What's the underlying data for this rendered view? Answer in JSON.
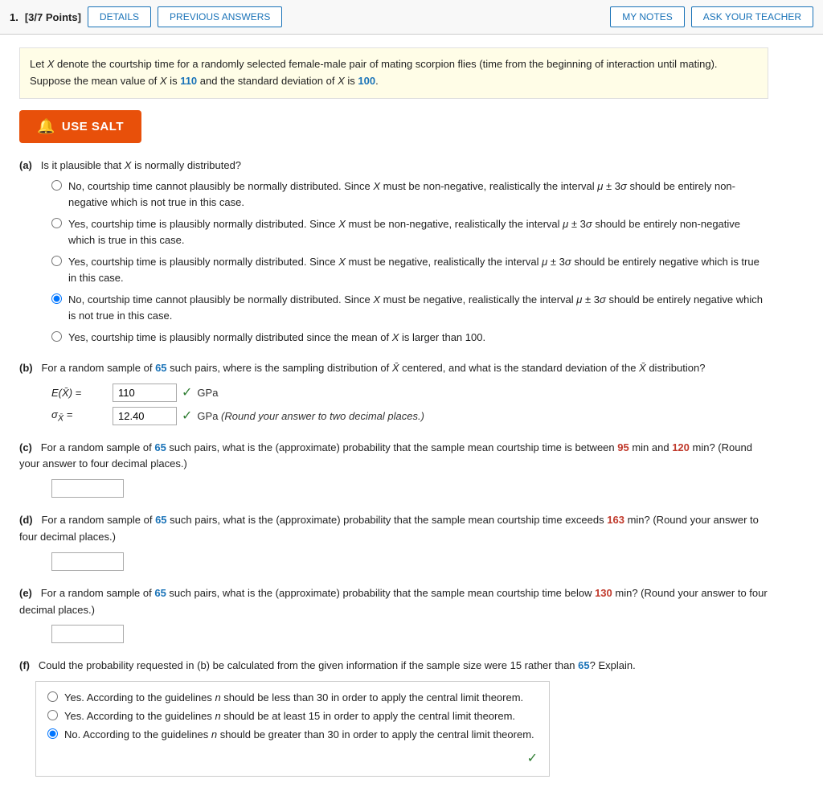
{
  "header": {
    "question_num": "1.",
    "points": "[3/7 Points]",
    "details_label": "DETAILS",
    "prev_answers_label": "PREVIOUS ANSWERS",
    "my_notes_label": "MY NOTES",
    "ask_teacher_label": "ASK YOUR TEACHER"
  },
  "intro": {
    "text1": "Let ",
    "var_x": "X",
    "text2": " denote the courtship time for a randomly selected female-male pair of mating scorpion flies (time from the beginning of interaction until mating). Suppose the mean value of ",
    "var_x2": "X",
    "text3": " is ",
    "mean_val": "110",
    "text4": " and the standard deviation of ",
    "var_x3": "X",
    "text5": " is ",
    "sd_val": "100",
    "text6": "."
  },
  "use_salt_label": "USE SALT",
  "parts": {
    "a": {
      "letter": "(a)",
      "question": "Is it plausible that X is normally distributed?",
      "options": [
        {
          "id": "a1",
          "selected": false,
          "text": "No, courtship time cannot plausibly be normally distributed. Since X must be non-negative, realistically the interval μ ± 3σ should be entirely non-negative which is not true in this case."
        },
        {
          "id": "a2",
          "selected": false,
          "text": "Yes, courtship time is plausibly normally distributed. Since X must be non-negative, realistically the interval μ ± 3σ should be entirely non-negative which is true in this case."
        },
        {
          "id": "a3",
          "selected": false,
          "text": "Yes, courtship time is plausibly normally distributed. Since X must be negative, realistically the interval μ ± 3σ should be entirely negative which is true in this case."
        },
        {
          "id": "a4",
          "selected": true,
          "text": "No, courtship time cannot plausibly be normally distributed. Since X must be negative, realistically the interval μ ± 3σ should be entirely negative which is not true in this case."
        },
        {
          "id": "a5",
          "selected": false,
          "text": "Yes, courtship time is plausibly normally distributed since the mean of X is larger than 100."
        }
      ]
    },
    "b": {
      "letter": "(b)",
      "question_start": "For a random sample of ",
      "n_val": "65",
      "question_mid": " such pairs, where is the sampling distribution of ",
      "question_end": " centered, and what is the standard deviation of the ",
      "question_end2": " distribution?",
      "e_label": "E(X̄) =",
      "e_value": "110",
      "e_unit": "GPa",
      "sigma_label": "σ X̄ =",
      "sigma_value": "12.40",
      "sigma_unit": "GPa",
      "sigma_note": "(Round your answer to two decimal places.)"
    },
    "c": {
      "letter": "(c)",
      "question_start": "For a random sample of ",
      "n_val": "65",
      "question_mid": " such pairs, what is the (approximate) probability that the sample mean courtship time is between ",
      "val1": "95",
      "text_mid": " min and ",
      "val2": "120",
      "question_end": " min? (Round your answer to four decimal places.)",
      "input_value": ""
    },
    "d": {
      "letter": "(d)",
      "question_start": "For a random sample of ",
      "n_val": "65",
      "question_mid": " such pairs, what is the (approximate) probability that the sample mean courtship time exceeds ",
      "val1": "163",
      "question_end": " min? (Round your answer to four decimal places.)",
      "input_value": ""
    },
    "e": {
      "letter": "(e)",
      "question_start": "For a random sample of ",
      "n_val": "65",
      "question_mid": " such pairs, what is the (approximate) probability that the sample mean courtship time below ",
      "val1": "130",
      "question_end": " min? (Round your answer to four decimal places.)",
      "input_value": ""
    },
    "f": {
      "letter": "(f)",
      "question_start": "Could the probability requested in (b) be calculated from the given information if the sample size were 15 rather than ",
      "n_val": "65",
      "question_end": "? Explain.",
      "options": [
        {
          "id": "f1",
          "selected": false,
          "text": "Yes. According to the guidelines n should be less than 30 in order to apply the central limit theorem."
        },
        {
          "id": "f2",
          "selected": false,
          "text": "Yes. According to the guidelines n should be at least 15 in order to apply the central limit theorem."
        },
        {
          "id": "f3",
          "selected": true,
          "text": "No. According to the guidelines n should be greater than 30 in order to apply the central limit theorem."
        }
      ]
    }
  },
  "colors": {
    "blue": "#1a73b8",
    "orange": "#e8500a",
    "green": "#2e7d32",
    "red_highlight": "#c0392b"
  }
}
